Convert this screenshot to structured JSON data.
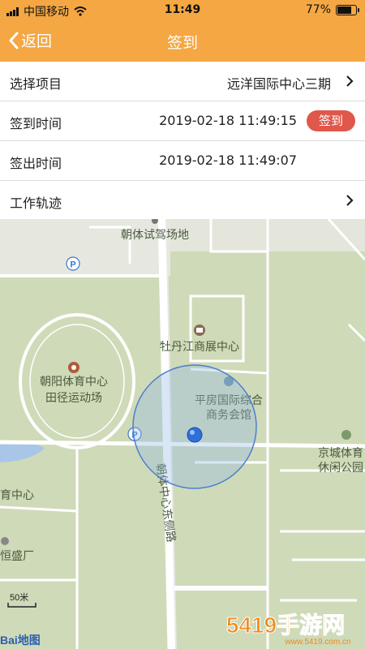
{
  "status_bar": {
    "carrier": "中国移动",
    "time": "11:49",
    "battery": "77%",
    "battery_level": 0.77
  },
  "nav": {
    "back_label": "返回",
    "title": "签到"
  },
  "rows": {
    "project": {
      "label": "选择项目",
      "value": "远洋国际中心三期"
    },
    "checkin": {
      "label": "签到时间",
      "value": "2019-02-18 11:49:15",
      "button": "签到"
    },
    "checkout": {
      "label": "签出时间",
      "value": "2019-02-18 11:49:07"
    },
    "track": {
      "label": "工作轨迹"
    }
  },
  "map": {
    "poi_driving_school": "朝体试驾场地",
    "poi_exhibition": "牡丹江商展中心",
    "poi_stadium_line1": "朝阳体育中心",
    "poi_stadium_line2": "田径运动场",
    "poi_business_line1": "平房国际综合",
    "poi_business_line2": "商务会馆",
    "poi_park_line1": "京城体育",
    "poi_park_line2": "休闲公园",
    "poi_sports_center_partial": "育中心",
    "poi_factory_partial": "恒盛厂",
    "road_label": "朝体中心东侧路",
    "scale_label": "50米",
    "logo_text": "Bai地图",
    "watermark": "5419手游网",
    "watermark_sub": "www.5419.com.cn",
    "colors": {
      "accent": "#f4a743",
      "checkin_button": "#e0574b",
      "map_land": "#cfdab8",
      "map_road": "#ffffff",
      "location": "#2e6fdc"
    }
  }
}
